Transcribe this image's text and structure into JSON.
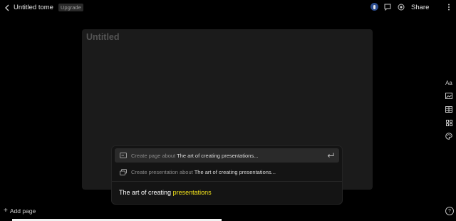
{
  "header": {
    "doc_title": "Untitled tome",
    "upgrade_label": "Upgrade",
    "share_label": "Share",
    "icons": [
      "chevron-left-icon",
      "user-avatar",
      "comment-icon",
      "play-icon",
      "more-icon"
    ]
  },
  "page": {
    "title": "Untitled"
  },
  "right_toolbar": {
    "text_tool_label": "Aa",
    "icons": [
      "text-icon",
      "image-icon",
      "table-icon",
      "grid-icon",
      "palette-icon"
    ]
  },
  "popup": {
    "options": [
      {
        "prefix": "Create page about",
        "topic": "The art of creating presentations...",
        "icon": "page-layout-icon"
      },
      {
        "prefix": "Create presentation about",
        "topic": "The art of creating presentations...",
        "icon": "presentation-icon"
      }
    ],
    "prompt_text": "The art of creating",
    "prompt_highlight": "presentations"
  },
  "footer": {
    "add_page_label": "Add page",
    "help_label": "?"
  },
  "colors": {
    "background": "#000000",
    "card": "#1b1b1b",
    "highlight": "#f2e21b",
    "avatar": "#2a4b8d"
  }
}
